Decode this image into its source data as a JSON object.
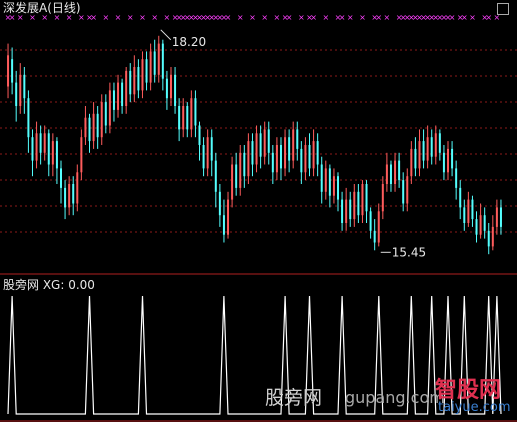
{
  "title": "深发展A(日线)",
  "indicator": {
    "label": "股旁网 XG: 0.00"
  },
  "annotations": {
    "high": "18.20",
    "low": "15.45"
  },
  "watermarks": [
    "股旁网",
    "gupang.com",
    "智股网",
    "taiyue.com"
  ],
  "colors": {
    "up": "#ff5c5c",
    "down": "#54ffff",
    "marker": "#ff40ff",
    "signal": "#ffffff",
    "grid": "#8b1a1a",
    "divider": "#b02020"
  },
  "chart_data": [
    {
      "type": "candlestick",
      "title": "深发展A(日线)",
      "y_range": [
        15.3,
        18.3
      ],
      "annotations": [
        {
          "text": "18.20",
          "bar": 37,
          "value": 18.2
        },
        {
          "text": "15.45",
          "bar": 91,
          "value": 15.45
        }
      ],
      "bars": [
        {
          "o": 17.55,
          "c": 17.95,
          "h": 18.1,
          "l": 17.4
        },
        {
          "o": 17.9,
          "c": 17.6,
          "h": 18.05,
          "l": 17.45
        },
        {
          "o": 17.6,
          "c": 17.3,
          "h": 17.75,
          "l": 17.1
        },
        {
          "o": 17.3,
          "c": 17.7,
          "h": 17.85,
          "l": 17.2
        },
        {
          "o": 17.7,
          "c": 17.4,
          "h": 17.8,
          "l": 17.2
        },
        {
          "o": 17.4,
          "c": 16.9,
          "h": 17.5,
          "l": 16.7
        },
        {
          "o": 16.9,
          "c": 16.6,
          "h": 17.0,
          "l": 16.4
        },
        {
          "o": 16.6,
          "c": 16.95,
          "h": 17.1,
          "l": 16.5
        },
        {
          "o": 16.95,
          "c": 16.7,
          "h": 17.05,
          "l": 16.55
        },
        {
          "o": 16.7,
          "c": 16.95,
          "h": 17.05,
          "l": 16.6
        },
        {
          "o": 16.95,
          "c": 16.55,
          "h": 17.0,
          "l": 16.4
        },
        {
          "o": 16.55,
          "c": 16.85,
          "h": 16.95,
          "l": 16.4
        },
        {
          "o": 16.85,
          "c": 16.5,
          "h": 16.9,
          "l": 16.3
        },
        {
          "o": 16.5,
          "c": 16.25,
          "h": 16.6,
          "l": 16.05
        },
        {
          "o": 16.25,
          "c": 16.0,
          "h": 16.35,
          "l": 15.85
        },
        {
          "o": 16.0,
          "c": 16.3,
          "h": 16.4,
          "l": 15.9
        },
        {
          "o": 16.3,
          "c": 16.05,
          "h": 16.4,
          "l": 15.9
        },
        {
          "o": 16.05,
          "c": 16.45,
          "h": 16.55,
          "l": 15.95
        },
        {
          "o": 16.45,
          "c": 16.9,
          "h": 17.0,
          "l": 16.35
        },
        {
          "o": 16.9,
          "c": 17.15,
          "h": 17.3,
          "l": 16.8
        },
        {
          "o": 17.15,
          "c": 16.85,
          "h": 17.2,
          "l": 16.7
        },
        {
          "o": 16.85,
          "c": 17.2,
          "h": 17.35,
          "l": 16.75
        },
        {
          "o": 17.2,
          "c": 16.9,
          "h": 17.3,
          "l": 16.75
        },
        {
          "o": 16.9,
          "c": 17.35,
          "h": 17.45,
          "l": 16.8
        },
        {
          "o": 17.35,
          "c": 17.05,
          "h": 17.45,
          "l": 16.95
        },
        {
          "o": 17.05,
          "c": 17.5,
          "h": 17.6,
          "l": 16.95
        },
        {
          "o": 17.5,
          "c": 17.25,
          "h": 17.6,
          "l": 17.1
        },
        {
          "o": 17.25,
          "c": 17.6,
          "h": 17.7,
          "l": 17.15
        },
        {
          "o": 17.6,
          "c": 17.3,
          "h": 17.65,
          "l": 17.2
        },
        {
          "o": 17.3,
          "c": 17.75,
          "h": 17.8,
          "l": 17.2
        },
        {
          "o": 17.75,
          "c": 17.45,
          "h": 17.85,
          "l": 17.35
        },
        {
          "o": 17.45,
          "c": 17.8,
          "h": 17.95,
          "l": 17.35
        },
        {
          "o": 17.8,
          "c": 17.5,
          "h": 17.9,
          "l": 17.4
        },
        {
          "o": 17.5,
          "c": 17.9,
          "h": 18.0,
          "l": 17.4
        },
        {
          "o": 17.9,
          "c": 17.6,
          "h": 18.0,
          "l": 17.5
        },
        {
          "o": 17.6,
          "c": 18.0,
          "h": 18.1,
          "l": 17.5
        },
        {
          "o": 18.0,
          "c": 17.7,
          "h": 18.15,
          "l": 17.6
        },
        {
          "o": 17.7,
          "c": 18.1,
          "h": 18.2,
          "l": 17.6
        },
        {
          "o": 18.1,
          "c": 17.65,
          "h": 18.15,
          "l": 17.5
        },
        {
          "o": 17.65,
          "c": 17.4,
          "h": 17.75,
          "l": 17.25
        },
        {
          "o": 17.4,
          "c": 17.7,
          "h": 17.8,
          "l": 17.3
        },
        {
          "o": 17.7,
          "c": 17.3,
          "h": 17.8,
          "l": 17.2
        },
        {
          "o": 17.3,
          "c": 17.0,
          "h": 17.4,
          "l": 16.85
        },
        {
          "o": 17.0,
          "c": 17.3,
          "h": 17.4,
          "l": 16.9
        },
        {
          "o": 17.3,
          "c": 17.0,
          "h": 17.35,
          "l": 16.9
        },
        {
          "o": 17.0,
          "c": 17.4,
          "h": 17.5,
          "l": 16.9
        },
        {
          "o": 17.4,
          "c": 17.05,
          "h": 17.5,
          "l": 16.9
        },
        {
          "o": 17.05,
          "c": 16.8,
          "h": 17.1,
          "l": 16.6
        },
        {
          "o": 16.8,
          "c": 16.5,
          "h": 16.9,
          "l": 16.4
        },
        {
          "o": 16.5,
          "c": 16.9,
          "h": 17.0,
          "l": 16.4
        },
        {
          "o": 16.9,
          "c": 16.6,
          "h": 17.0,
          "l": 16.4
        },
        {
          "o": 16.6,
          "c": 16.2,
          "h": 16.7,
          "l": 16.0
        },
        {
          "o": 16.2,
          "c": 15.9,
          "h": 16.3,
          "l": 15.75
        },
        {
          "o": 15.9,
          "c": 15.65,
          "h": 16.1,
          "l": 15.55
        },
        {
          "o": 15.65,
          "c": 16.1,
          "h": 16.2,
          "l": 15.6
        },
        {
          "o": 16.1,
          "c": 16.55,
          "h": 16.65,
          "l": 16.0
        },
        {
          "o": 16.55,
          "c": 16.25,
          "h": 16.7,
          "l": 16.15
        },
        {
          "o": 16.25,
          "c": 16.7,
          "h": 16.8,
          "l": 16.15
        },
        {
          "o": 16.7,
          "c": 16.4,
          "h": 16.8,
          "l": 16.25
        },
        {
          "o": 16.4,
          "c": 16.85,
          "h": 16.95,
          "l": 16.3
        },
        {
          "o": 16.85,
          "c": 16.55,
          "h": 16.95,
          "l": 16.4
        },
        {
          "o": 16.55,
          "c": 16.95,
          "h": 17.05,
          "l": 16.45
        },
        {
          "o": 16.95,
          "c": 16.65,
          "h": 17.05,
          "l": 16.5
        },
        {
          "o": 16.65,
          "c": 17.0,
          "h": 17.1,
          "l": 16.55
        },
        {
          "o": 17.0,
          "c": 16.7,
          "h": 17.1,
          "l": 16.55
        },
        {
          "o": 16.7,
          "c": 16.45,
          "h": 16.8,
          "l": 16.3
        },
        {
          "o": 16.45,
          "c": 16.8,
          "h": 16.9,
          "l": 16.35
        },
        {
          "o": 16.8,
          "c": 16.5,
          "h": 16.9,
          "l": 16.35
        },
        {
          "o": 16.5,
          "c": 16.9,
          "h": 17.0,
          "l": 16.4
        },
        {
          "o": 16.9,
          "c": 16.6,
          "h": 17.0,
          "l": 16.45
        },
        {
          "o": 16.6,
          "c": 17.0,
          "h": 17.1,
          "l": 16.5
        },
        {
          "o": 17.0,
          "c": 16.75,
          "h": 17.1,
          "l": 16.6
        },
        {
          "o": 16.75,
          "c": 16.45,
          "h": 16.85,
          "l": 16.3
        },
        {
          "o": 16.45,
          "c": 16.8,
          "h": 16.9,
          "l": 16.35
        },
        {
          "o": 16.8,
          "c": 16.5,
          "h": 16.95,
          "l": 16.4
        },
        {
          "o": 16.5,
          "c": 16.85,
          "h": 17.0,
          "l": 16.4
        },
        {
          "o": 16.85,
          "c": 16.55,
          "h": 16.95,
          "l": 16.4
        },
        {
          "o": 16.55,
          "c": 16.2,
          "h": 16.65,
          "l": 16.05
        },
        {
          "o": 16.2,
          "c": 16.5,
          "h": 16.6,
          "l": 16.1
        },
        {
          "o": 16.5,
          "c": 16.15,
          "h": 16.55,
          "l": 16.0
        },
        {
          "o": 16.15,
          "c": 16.4,
          "h": 16.5,
          "l": 16.05
        },
        {
          "o": 16.4,
          "c": 16.1,
          "h": 16.45,
          "l": 15.95
        },
        {
          "o": 16.1,
          "c": 15.8,
          "h": 16.2,
          "l": 15.7
        },
        {
          "o": 15.8,
          "c": 16.1,
          "h": 16.25,
          "l": 15.7
        },
        {
          "o": 16.1,
          "c": 15.85,
          "h": 16.2,
          "l": 15.75
        },
        {
          "o": 15.85,
          "c": 16.2,
          "h": 16.3,
          "l": 15.75
        },
        {
          "o": 16.2,
          "c": 15.9,
          "h": 16.3,
          "l": 15.8
        },
        {
          "o": 15.9,
          "c": 16.3,
          "h": 16.35,
          "l": 15.8
        },
        {
          "o": 16.3,
          "c": 15.95,
          "h": 16.35,
          "l": 15.8
        },
        {
          "o": 15.95,
          "c": 15.7,
          "h": 16.0,
          "l": 15.6
        },
        {
          "o": 15.7,
          "c": 15.55,
          "h": 15.85,
          "l": 15.45
        },
        {
          "o": 15.55,
          "c": 15.95,
          "h": 16.05,
          "l": 15.5
        },
        {
          "o": 15.95,
          "c": 16.3,
          "h": 16.4,
          "l": 15.85
        },
        {
          "o": 16.3,
          "c": 16.55,
          "h": 16.7,
          "l": 16.2
        },
        {
          "o": 16.55,
          "c": 16.3,
          "h": 16.6,
          "l": 16.2
        },
        {
          "o": 16.3,
          "c": 16.6,
          "h": 16.7,
          "l": 16.2
        },
        {
          "o": 16.6,
          "c": 16.35,
          "h": 16.7,
          "l": 16.25
        },
        {
          "o": 16.35,
          "c": 16.05,
          "h": 16.45,
          "l": 15.95
        },
        {
          "o": 16.05,
          "c": 16.4,
          "h": 16.5,
          "l": 15.95
        },
        {
          "o": 16.4,
          "c": 16.75,
          "h": 16.85,
          "l": 16.3
        },
        {
          "o": 16.75,
          "c": 16.5,
          "h": 16.9,
          "l": 16.4
        },
        {
          "o": 16.5,
          "c": 16.85,
          "h": 17.0,
          "l": 16.4
        },
        {
          "o": 16.85,
          "c": 16.6,
          "h": 17.0,
          "l": 16.5
        },
        {
          "o": 16.6,
          "c": 16.9,
          "h": 17.05,
          "l": 16.5
        },
        {
          "o": 16.9,
          "c": 16.65,
          "h": 17.0,
          "l": 16.55
        },
        {
          "o": 16.65,
          "c": 16.95,
          "h": 17.05,
          "l": 16.55
        },
        {
          "o": 16.95,
          "c": 16.7,
          "h": 17.0,
          "l": 16.6
        },
        {
          "o": 16.7,
          "c": 16.45,
          "h": 16.8,
          "l": 16.35
        },
        {
          "o": 16.45,
          "c": 16.75,
          "h": 16.85,
          "l": 16.35
        },
        {
          "o": 16.75,
          "c": 16.5,
          "h": 16.85,
          "l": 16.4
        },
        {
          "o": 16.5,
          "c": 16.25,
          "h": 16.6,
          "l": 16.1
        },
        {
          "o": 16.25,
          "c": 16.0,
          "h": 16.35,
          "l": 15.85
        },
        {
          "o": 16.0,
          "c": 15.8,
          "h": 16.1,
          "l": 15.7
        },
        {
          "o": 15.8,
          "c": 16.1,
          "h": 16.2,
          "l": 15.75
        },
        {
          "o": 16.1,
          "c": 15.85,
          "h": 16.15,
          "l": 15.75
        },
        {
          "o": 15.85,
          "c": 15.65,
          "h": 15.95,
          "l": 15.55
        },
        {
          "o": 15.65,
          "c": 15.9,
          "h": 16.05,
          "l": 15.6
        },
        {
          "o": 15.9,
          "c": 15.7,
          "h": 16.0,
          "l": 15.6
        },
        {
          "o": 15.7,
          "c": 15.5,
          "h": 15.8,
          "l": 15.4
        },
        {
          "o": 15.5,
          "c": 15.75,
          "h": 15.9,
          "l": 15.45
        },
        {
          "o": 15.75,
          "c": 16.0,
          "h": 16.1,
          "l": 15.65
        },
        {
          "o": 16.0,
          "c": 15.75,
          "h": 16.1,
          "l": 15.65
        }
      ]
    },
    {
      "type": "line",
      "title": "股旁网 XG: 0.00",
      "y_range": [
        0,
        1
      ],
      "signal_bars": [
        1,
        20,
        33,
        53,
        68,
        74,
        82,
        91,
        99,
        104,
        108,
        112,
        118,
        120
      ],
      "value_off_signal": 0,
      "value_on_signal": 1
    }
  ]
}
